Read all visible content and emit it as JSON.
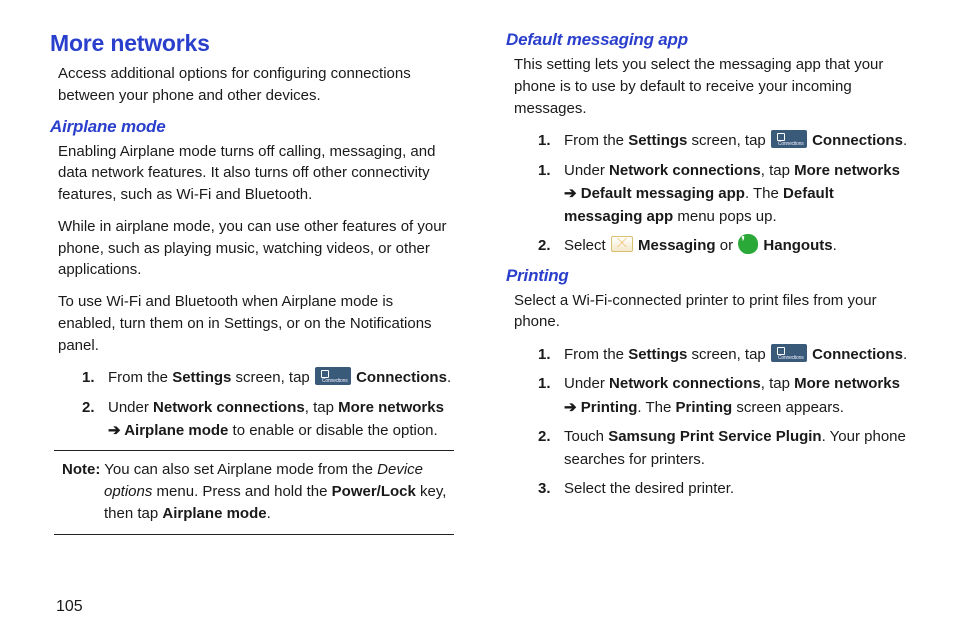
{
  "page_number": "105",
  "left_col": {
    "heading": "More networks",
    "intro": "Access additional options for configuring connections between your phone and other devices.",
    "airplane": {
      "heading": "Airplane mode",
      "p1": "Enabling Airplane mode turns off calling, messaging, and data network features. It also turns off other connectivity features, such as Wi-Fi and Bluetooth.",
      "p2": "While in airplane mode, you can use other features of your phone, such as playing music, watching videos, or other applications.",
      "p3": "To use Wi-Fi and Bluetooth when Airplane mode is enabled, turn them on in Settings, or on the Notifications panel.",
      "step1_num": "1.",
      "step1_a": "From the ",
      "step1_b": "Settings",
      "step1_c": " screen, tap ",
      "step1_d": "Connections",
      "step1_e": ".",
      "step2_num": "2.",
      "step2_a": "Under ",
      "step2_b": "Network connections",
      "step2_c": ", tap ",
      "step2_d": "More networks",
      "step2_arrow": " ➔ ",
      "step2_e": "Airplane mode",
      "step2_f": " to enable or disable the option.",
      "note_label": "Note:",
      "note_a": " You can also set Airplane mode from the ",
      "note_b": "Device options",
      "note_c": " menu. Press and hold the ",
      "note_d": "Power/Lock",
      "note_e": " key, then tap ",
      "note_f": "Airplane mode",
      "note_g": "."
    }
  },
  "right_col": {
    "messaging": {
      "heading": "Default messaging app",
      "intro": "This setting lets you select the messaging app that your phone is to use by default to receive your incoming messages.",
      "step1_num": "1.",
      "step1_a": "From the ",
      "step1_b": "Settings",
      "step1_c": " screen, tap ",
      "step1_d": "Connections",
      "step1_e": ".",
      "step1b_num": "1.",
      "step1b_a": "Under ",
      "step1b_b": "Network connections",
      "step1b_c": ", tap ",
      "step1b_d": "More networks",
      "step1b_arrow": " ➔ ",
      "step1b_e": "Default messaging app",
      "step1b_f": ". The ",
      "step1b_g": "Default messaging app",
      "step1b_h": " menu pops up.",
      "step2_num": "2.",
      "step2_a": "Select ",
      "step2_b": "Messaging",
      "step2_c": " or ",
      "step2_d": "Hangouts",
      "step2_e": "."
    },
    "printing": {
      "heading": "Printing",
      "intro": "Select a Wi-Fi-connected printer to print files from your phone.",
      "step1_num": "1.",
      "step1_a": "From the ",
      "step1_b": "Settings",
      "step1_c": " screen, tap ",
      "step1_d": "Connections",
      "step1_e": ".",
      "step1b_num": "1.",
      "step1b_a": "Under ",
      "step1b_b": "Network connections",
      "step1b_c": ", tap ",
      "step1b_d": "More networks",
      "step1b_arrow": " ➔ ",
      "step1b_e": "Printing",
      "step1b_f": ". The ",
      "step1b_g": "Printing",
      "step1b_h": " screen appears.",
      "step2_num": "2.",
      "step2_a": "Touch ",
      "step2_b": "Samsung Print Service Plugin",
      "step2_c": ". Your phone searches for printers.",
      "step3_num": "3.",
      "step3_a": "Select the desired printer."
    }
  }
}
